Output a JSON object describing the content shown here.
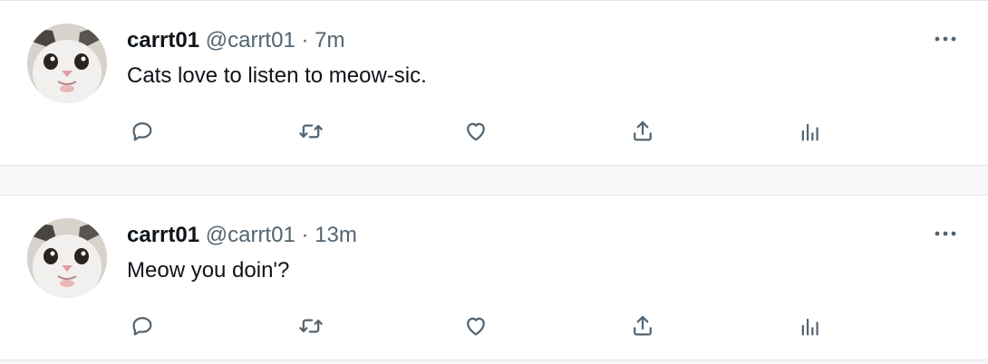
{
  "tweets": [
    {
      "author": "carrt01",
      "handle": "@carrt01",
      "separator": "·",
      "time": "7m",
      "text": "Cats love to listen to meow-sic."
    },
    {
      "author": "carrt01",
      "handle": "@carrt01",
      "separator": "·",
      "time": "13m",
      "text": "Meow you doin'?"
    }
  ],
  "icons": {
    "avatar": "cat-avatar",
    "more": "more-icon",
    "reply": "reply-icon",
    "retweet": "retweet-icon",
    "like": "heart-icon",
    "share": "share-icon",
    "views": "views-icon"
  },
  "colors": {
    "text": "#0f1419",
    "muted": "#536471",
    "background": "#f7f7f7",
    "card": "#ffffff"
  }
}
